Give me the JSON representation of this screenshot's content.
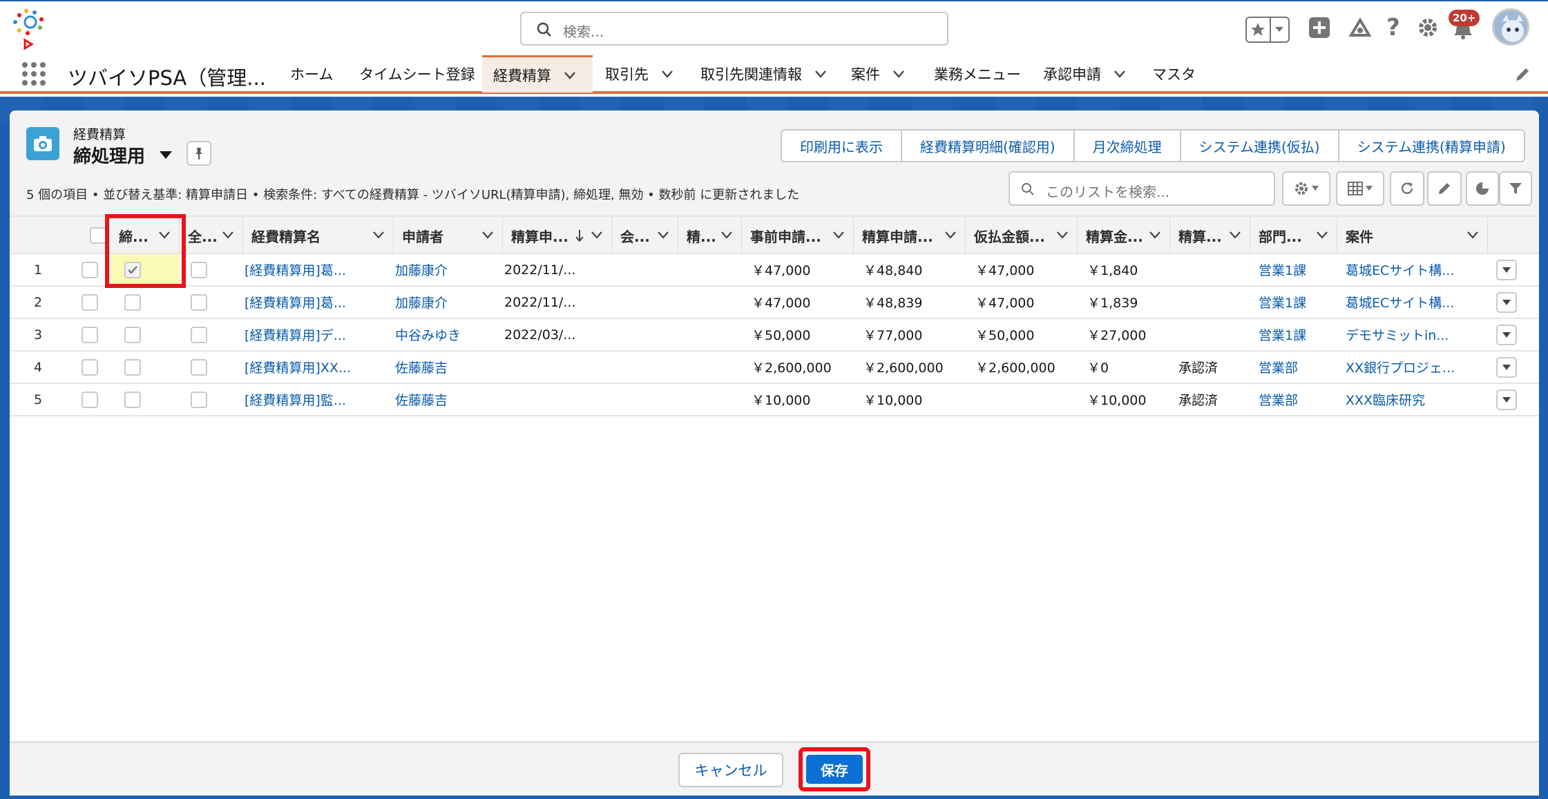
{
  "header": {
    "search_placeholder": "検索...",
    "notification_count": "20+"
  },
  "app": {
    "name": "ツバイソPSA（管理...",
    "nav": [
      {
        "label": "ホーム",
        "has_menu": false,
        "active": false
      },
      {
        "label": "タイムシート登録",
        "has_menu": false,
        "active": false
      },
      {
        "label": "経費精算",
        "has_menu": true,
        "active": true
      },
      {
        "label": "取引先",
        "has_menu": true,
        "active": false
      },
      {
        "label": "取引先関連情報",
        "has_menu": true,
        "active": false
      },
      {
        "label": "案件",
        "has_menu": true,
        "active": false
      },
      {
        "label": "業務メニュー",
        "has_menu": false,
        "active": false
      },
      {
        "label": "承認申請",
        "has_menu": true,
        "active": false
      },
      {
        "label": "マスタ",
        "has_menu": false,
        "active": false
      }
    ]
  },
  "list": {
    "object_label": "経費精算",
    "view_name": "締処理用",
    "actions": [
      "印刷用に表示",
      "経費精算明細(確認用)",
      "月次締処理",
      "システム連携(仮払)",
      "システム連携(精算申請)"
    ],
    "meta": "5 個の項目 • 並び替え基準: 精算申請日 • 検索条件: すべての経費精算 - ツバイソURL(精算申請), 締処理, 無効 • 数秒前 に更新されました",
    "search_placeholder": "このリストを検索..."
  },
  "table": {
    "columns": [
      "締...",
      "全...",
      "経費精算名",
      "申請者",
      "精算申...",
      "会...",
      "精...",
      "事前申請...",
      "精算申請...",
      "仮払金額...",
      "精算金...",
      "精算...",
      "部門...",
      "案件"
    ],
    "rows": [
      {
        "num": "1",
        "closing_checked": true,
        "name": "[経費精算用]葛...",
        "applicant": "加藤康介",
        "date": "2022/11/...",
        "pre_amount": "￥47,000",
        "claim_amount": "￥48,840",
        "advance": "￥47,000",
        "settle": "￥1,840",
        "status": "",
        "dept": "営業1課",
        "project": "葛城ECサイト構..."
      },
      {
        "num": "2",
        "closing_checked": false,
        "name": "[経費精算用]葛...",
        "applicant": "加藤康介",
        "date": "2022/11/...",
        "pre_amount": "￥47,000",
        "claim_amount": "￥48,839",
        "advance": "￥47,000",
        "settle": "￥1,839",
        "status": "",
        "dept": "営業1課",
        "project": "葛城ECサイト構..."
      },
      {
        "num": "3",
        "closing_checked": false,
        "name": "[経費精算用]デ...",
        "applicant": "中谷みゆき",
        "date": "2022/03/...",
        "pre_amount": "￥50,000",
        "claim_amount": "￥77,000",
        "advance": "￥50,000",
        "settle": "￥27,000",
        "status": "",
        "dept": "営業1課",
        "project": "デモサミットin..."
      },
      {
        "num": "4",
        "closing_checked": false,
        "name": "[経費精算用]XX...",
        "applicant": "佐藤藤吉",
        "date": "",
        "pre_amount": "￥2,600,000",
        "claim_amount": "￥2,600,000",
        "advance": "￥2,600,000",
        "settle": "￥0",
        "status": "承認済",
        "dept": "営業部",
        "project": "XX銀行プロジェ..."
      },
      {
        "num": "5",
        "closing_checked": false,
        "name": "[経費精算用]監...",
        "applicant": "佐藤藤吉",
        "date": "",
        "pre_amount": "￥10,000",
        "claim_amount": "￥10,000",
        "advance": "",
        "settle": "￥10,000",
        "status": "承認済",
        "dept": "営業部",
        "project": "XXX臨床研究"
      }
    ]
  },
  "footer": {
    "cancel_label": "キャンセル",
    "save_label": "保存"
  },
  "colors": {
    "brand_blue": "#1b5fae",
    "link": "#0b5cab",
    "primary_button": "#0b70d6",
    "nav_accent": "#e16f39",
    "highlight_red": "#e8141b",
    "edited_cell": "#fafab4"
  },
  "icons": [
    "app-logo-icon",
    "search-icon",
    "star-icon",
    "add-icon",
    "trailhead-icon",
    "help-icon",
    "gear-icon",
    "bell-icon",
    "avatar",
    "waffle-icon",
    "pencil-icon",
    "camera-icon",
    "pin-icon",
    "refresh-icon",
    "table-icon",
    "chart-icon",
    "filter-icon"
  ]
}
